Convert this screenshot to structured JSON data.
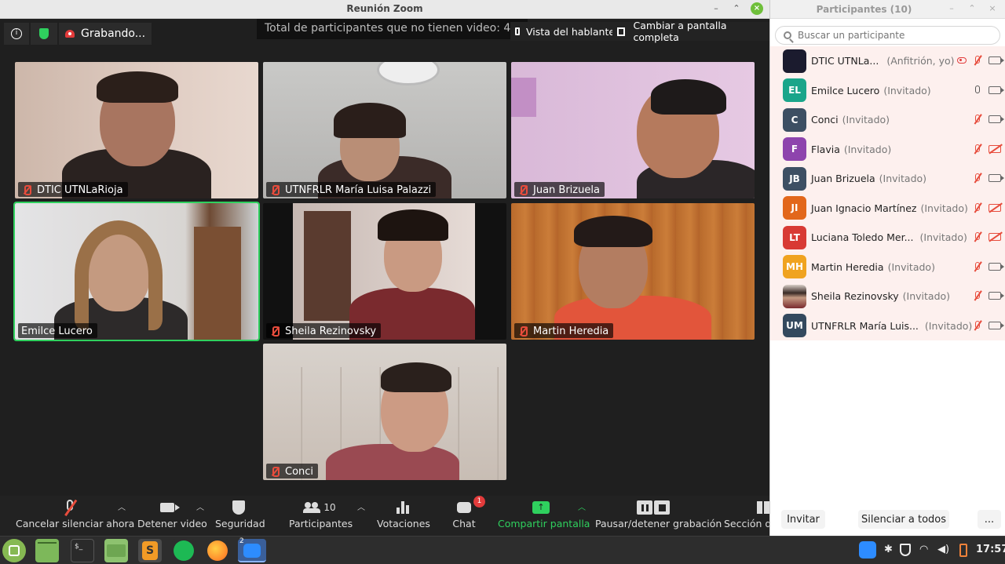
{
  "window": {
    "title": "Reunión Zoom",
    "minimize": "–",
    "maximize": "⌃",
    "close": "×"
  },
  "top_bar": {
    "recording_label": "Grabando...",
    "no_video_banner": "Total de participantes que no tienen video: 4 ▾",
    "speaker_view": "Vista del hablante",
    "fullscreen": "Cambiar a pantalla completa"
  },
  "tiles": [
    {
      "name": "DTIC UTNLaRioja",
      "muted": true
    },
    {
      "name": "UTNFRLR María Luisa Palazzi",
      "muted": true
    },
    {
      "name": "Juan Brizuela",
      "muted": true
    },
    {
      "name": "Emilce Lucero",
      "muted": false
    },
    {
      "name": "Sheila Rezinovsky",
      "muted": true
    },
    {
      "name": "Martin Heredia",
      "muted": true
    },
    {
      "name": "Conci",
      "muted": true
    }
  ],
  "toolbar": {
    "unmute": "Cancelar silenciar ahora",
    "stop_video": "Detener video",
    "security": "Seguridad",
    "participants": "Participantes",
    "participants_count": "10",
    "polls": "Votaciones",
    "chat": "Chat",
    "chat_badge": "1",
    "share": "Compartir pantalla",
    "pause_record": "Pausar/detener grabación",
    "gallery": "Sección de"
  },
  "panel": {
    "title": "Participantes (10)",
    "search_placeholder": "Buscar un participante",
    "invite": "Invitar",
    "mute_all": "Silenciar a todos",
    "more": "...",
    "participants": [
      {
        "initials": "",
        "name": "DTIC UTNLa...",
        "role": "(Anfitrión, yo)",
        "color": "#1b1b2e",
        "mic": "muted",
        "cam": "on",
        "rec": true
      },
      {
        "initials": "EL",
        "name": "Emilce Lucero",
        "role": "(Invitado)",
        "color": "#1aa58a",
        "mic": "on",
        "cam": "on",
        "rec": false
      },
      {
        "initials": "C",
        "name": "Conci",
        "role": "(Invitado)",
        "color": "#3d4f63",
        "mic": "muted",
        "cam": "on",
        "rec": false
      },
      {
        "initials": "F",
        "name": "Flavia",
        "role": "(Invitado)",
        "color": "#8e44ad",
        "mic": "muted",
        "cam": "off",
        "rec": false
      },
      {
        "initials": "JB",
        "name": "Juan Brizuela",
        "role": "(Invitado)",
        "color": "#3d4f63",
        "mic": "muted",
        "cam": "on",
        "rec": false
      },
      {
        "initials": "JI",
        "name": "Juan Ignacio Martínez",
        "role": "(Invitado)",
        "color": "#e2671b",
        "mic": "muted",
        "cam": "off",
        "rec": false
      },
      {
        "initials": "LT",
        "name": "Luciana Toledo Mer...",
        "role": "(Invitado)",
        "color": "#d83a34",
        "mic": "muted",
        "cam": "off",
        "rec": false
      },
      {
        "initials": "MH",
        "name": "Martin Heredia",
        "role": "(Invitado)",
        "color": "#f0a320",
        "mic": "muted",
        "cam": "on",
        "rec": false
      },
      {
        "initials": "",
        "name": "Sheila Rezinovsky",
        "role": "(Invitado)",
        "color": "#b9a99a",
        "mic": "muted",
        "cam": "on",
        "rec": false
      },
      {
        "initials": "UM",
        "name": "UTNFRLR María Luis...",
        "role": "(Invitado)",
        "color": "#34495e",
        "mic": "muted",
        "cam": "on",
        "rec": false
      }
    ]
  },
  "taskbar": {
    "terminal_label": "$_",
    "zoom_badge": "2",
    "clock": "17:57"
  }
}
